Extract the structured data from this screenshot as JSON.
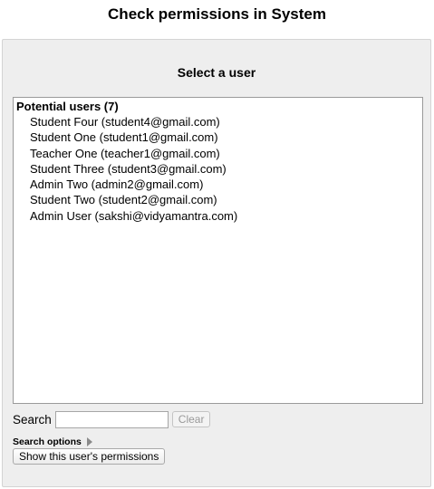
{
  "page": {
    "title": "Check permissions in System"
  },
  "panel": {
    "heading": "Select a user",
    "list": {
      "group_label": "Potential users (7)",
      "options": [
        "Student Four (student4@gmail.com)",
        "Student One (student1@gmail.com)",
        "Teacher One (teacher1@gmail.com)",
        "Student Three (student3@gmail.com)",
        "Admin Two (admin2@gmail.com)",
        "Student Two (student2@gmail.com)",
        "Admin User (sakshi@vidyamantra.com)"
      ]
    },
    "search": {
      "label": "Search",
      "value": "",
      "clear_label": "Clear"
    },
    "search_options_label": "Search options",
    "show_permissions_label": "Show this user's permissions"
  },
  "icons": {
    "search_options_toggle": "triangle-right-icon"
  }
}
